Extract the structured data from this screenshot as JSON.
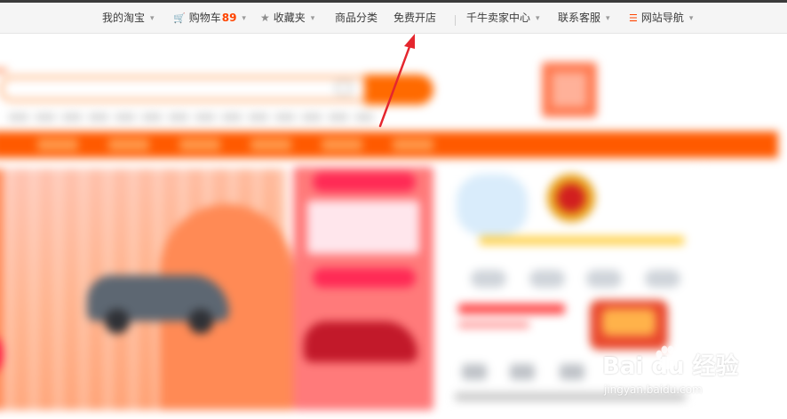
{
  "site_nav": {
    "items": [
      {
        "label": "我的淘宝",
        "has_dropdown": true
      },
      {
        "label": "购物车",
        "count": "89",
        "has_dropdown": true,
        "icon": "cart-icon"
      },
      {
        "label": "收藏夹",
        "has_dropdown": true,
        "icon": "star-icon"
      },
      {
        "label": "商品分类",
        "has_dropdown": false
      },
      {
        "label": "免费开店",
        "has_dropdown": false
      },
      {
        "label": "千牛卖家中心",
        "has_dropdown": true
      },
      {
        "label": "联系客服",
        "has_dropdown": true
      },
      {
        "label": "网站导航",
        "has_dropdown": true,
        "icon": "menu-icon"
      }
    ],
    "caret_glyph": "▾"
  },
  "annotation": {
    "type": "arrow",
    "color": "#e5262e",
    "points_to": "免费开店"
  },
  "watermark": {
    "brand": "Bai du 经验",
    "url": "jingyan.baidu.com",
    "icon": "paw-icon"
  },
  "colors": {
    "accent": "#ff5000",
    "nav_bg": "#f5f5f5",
    "arrow": "#e5262e"
  }
}
